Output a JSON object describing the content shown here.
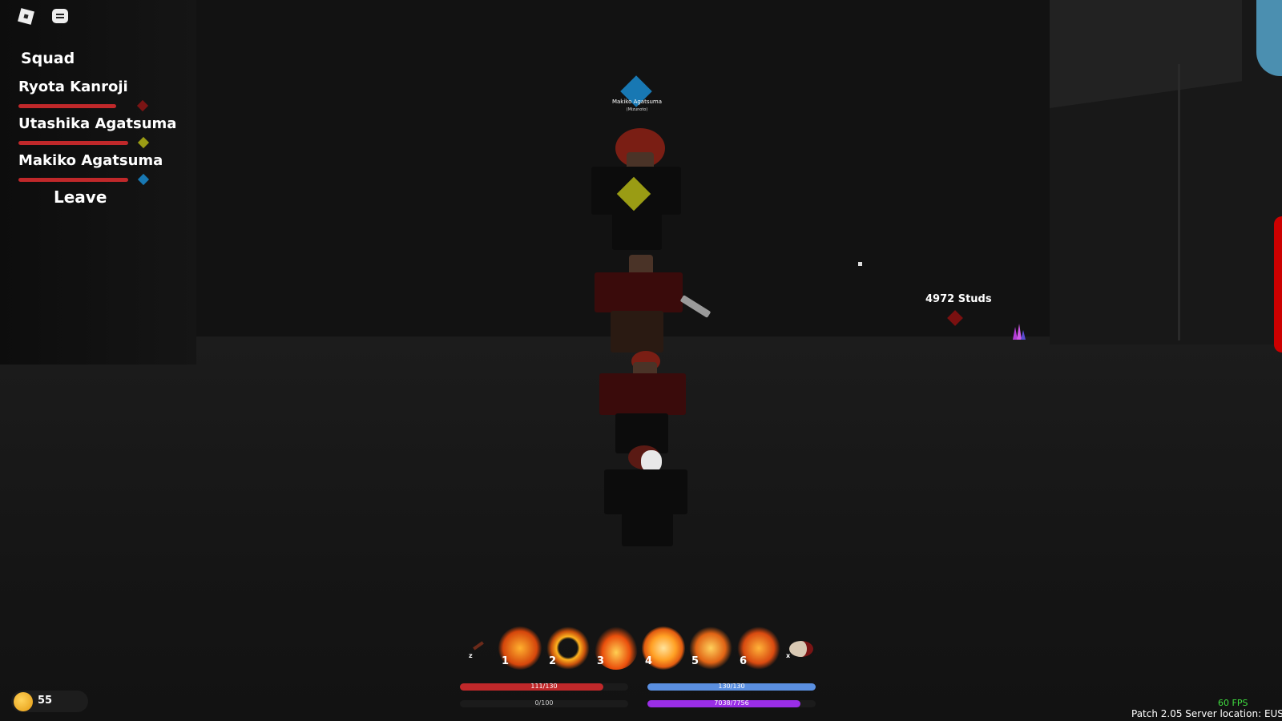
{
  "squad": {
    "title": "Squad",
    "members": [
      {
        "name": "Ryota Kanroji",
        "health": 1.0,
        "marker_color": "#7a1414"
      },
      {
        "name": "Utashika Agatsuma",
        "health": 1.0,
        "marker_color": "#9a9c14"
      },
      {
        "name": "Makiko Agatsuma",
        "health": 1.0,
        "marker_color": "#1878b3"
      }
    ],
    "leave_label": "Leave"
  },
  "overhead": {
    "name": "Makiko Agatsuma",
    "subtitle": "(Mizunoto)",
    "marker_color": "#1878b3"
  },
  "waypoint": {
    "label": "4972 Studs",
    "marker_color": "#7a1010"
  },
  "hotbar": {
    "key_left": "z",
    "key_right": "x",
    "slots": [
      {
        "key": "1",
        "icon": "flame-sword-icon"
      },
      {
        "key": "2",
        "icon": "flame-crescent-icon"
      },
      {
        "key": "3",
        "icon": "flame-slash-icon"
      },
      {
        "key": "4",
        "icon": "flame-orb-icon"
      },
      {
        "key": "5",
        "icon": "flame-burst-icon"
      },
      {
        "key": "6",
        "icon": "flame-dragon-icon"
      }
    ]
  },
  "stats": {
    "health": {
      "text": "111/130",
      "value": 111,
      "max": 130,
      "color": "#c0282a"
    },
    "stamina": {
      "text": "130/130",
      "value": 130,
      "max": 130,
      "color": "#5a8fe0"
    },
    "bottom_left": {
      "text": "0/100",
      "value": 0,
      "max": 100
    },
    "bottom_right": {
      "text": "7038/7756",
      "value": 7038,
      "max": 7756,
      "color": "#9a2ee6"
    }
  },
  "currency": {
    "amount": "55",
    "icon": "coin-icon"
  },
  "footer": {
    "fps": "60 FPS",
    "patch": "Patch 2.05   Server location: EUS"
  }
}
